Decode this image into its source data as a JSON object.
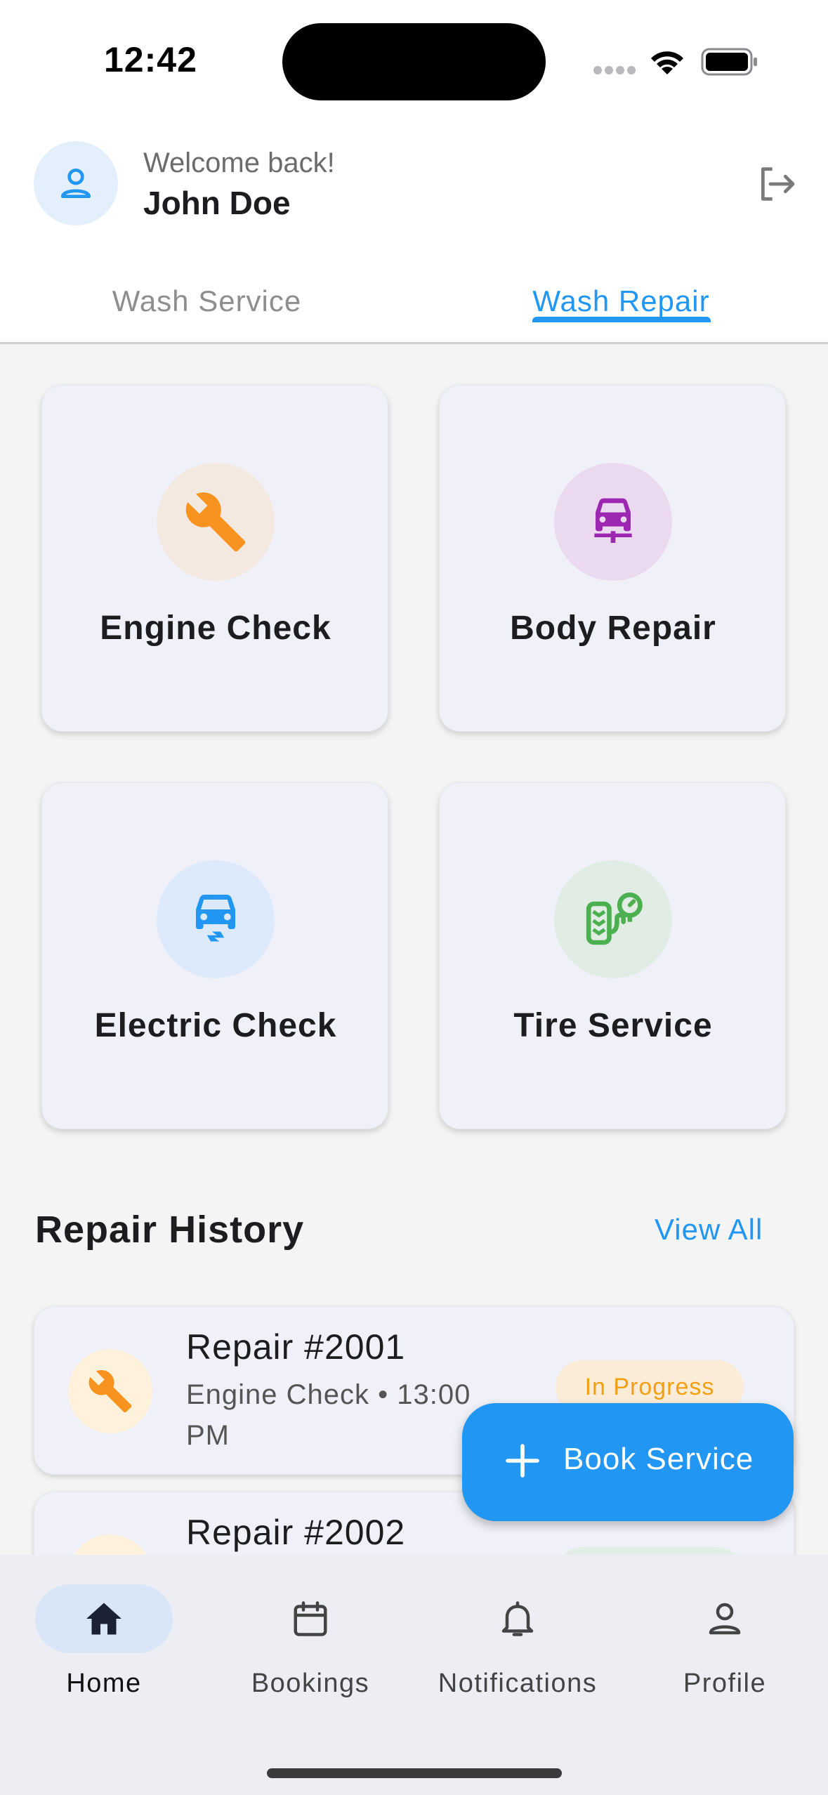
{
  "status_bar": {
    "time": "12:42"
  },
  "header": {
    "welcome": "Welcome back!",
    "user_name": "John Doe",
    "avatar_icon": "person-icon",
    "logout_icon": "logout-icon"
  },
  "tabs": [
    {
      "label": "Wash Service",
      "active": false
    },
    {
      "label": "Wash Repair",
      "active": true
    }
  ],
  "services": [
    {
      "title": "Engine Check",
      "icon": "wrench-icon",
      "color": "#f7931e",
      "bg": "#f3e9e1"
    },
    {
      "title": "Body Repair",
      "icon": "car-repair-icon",
      "color": "#9c27b0",
      "bg": "#ead9ef"
    },
    {
      "title": "Electric Check",
      "icon": "electric-car-icon",
      "color": "#2196f3",
      "bg": "#ddeafb"
    },
    {
      "title": "Tire Service",
      "icon": "tire-pressure-icon",
      "color": "#4caf50",
      "bg": "#e0ece4"
    }
  ],
  "history": {
    "title": "Repair History",
    "view_all": "View All",
    "items": [
      {
        "title": "Repair #2001",
        "subtitle": "Engine Check • 13:00 PM",
        "status": "In Progress",
        "icon": "wrench-icon"
      },
      {
        "title": "Repair #2002",
        "subtitle": "",
        "status": "",
        "icon": "wrench-icon"
      }
    ]
  },
  "fab": {
    "label": "Book Service",
    "icon": "plus-icon"
  },
  "bottom_nav": [
    {
      "label": "Home",
      "icon": "home-icon",
      "active": true
    },
    {
      "label": "Bookings",
      "icon": "calendar-icon",
      "active": false
    },
    {
      "label": "Notifications",
      "icon": "bell-icon",
      "active": false
    },
    {
      "label": "Profile",
      "icon": "person-icon",
      "active": false
    }
  ],
  "colors": {
    "accent": "#2196f3",
    "status_in_progress": "#f29f12"
  }
}
